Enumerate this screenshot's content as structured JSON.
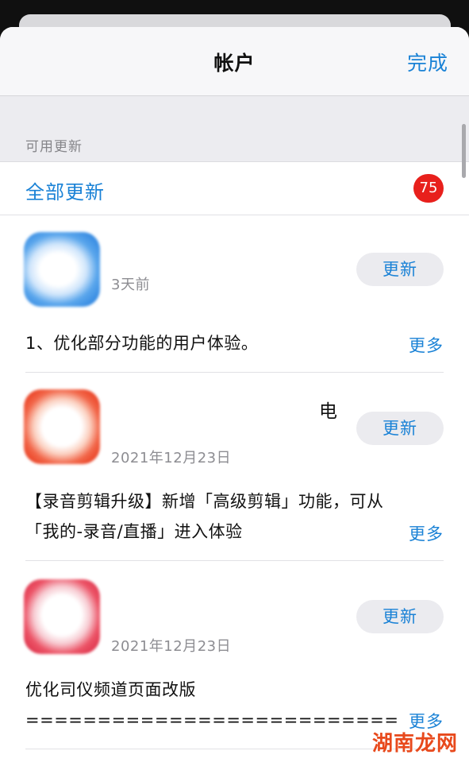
{
  "nav": {
    "title": "帐户",
    "done_label": "完成"
  },
  "section": {
    "header": "可用更新",
    "update_all_label": "全部更新",
    "badge_count": "75"
  },
  "apps": [
    {
      "name": "",
      "date": "3天前",
      "update_label": "更新",
      "notes": [
        "1、优化部分功能的用户体验。"
      ],
      "more_label": "更多",
      "icon_color": "#2f85e0"
    },
    {
      "name": "电",
      "date": "2021年12月23日",
      "update_label": "更新",
      "notes": [
        "【录音剪辑升级】新增「高级剪辑」功能，可从",
        "「我的-录音/直播」进入体验"
      ],
      "more_label": "更多",
      "icon_color": "#e8391c"
    },
    {
      "name": "",
      "date": "2021年12月23日",
      "update_label": "更新",
      "notes": [
        "优化司仪频道页面改版",
        "=================================="
      ],
      "more_label": "更多",
      "icon_color": "#dc2f48"
    }
  ],
  "watermark": "湖南龙网",
  "colors": {
    "accent": "#1a82d6",
    "badge": "#e8201c",
    "button_bg": "#ebebef"
  }
}
